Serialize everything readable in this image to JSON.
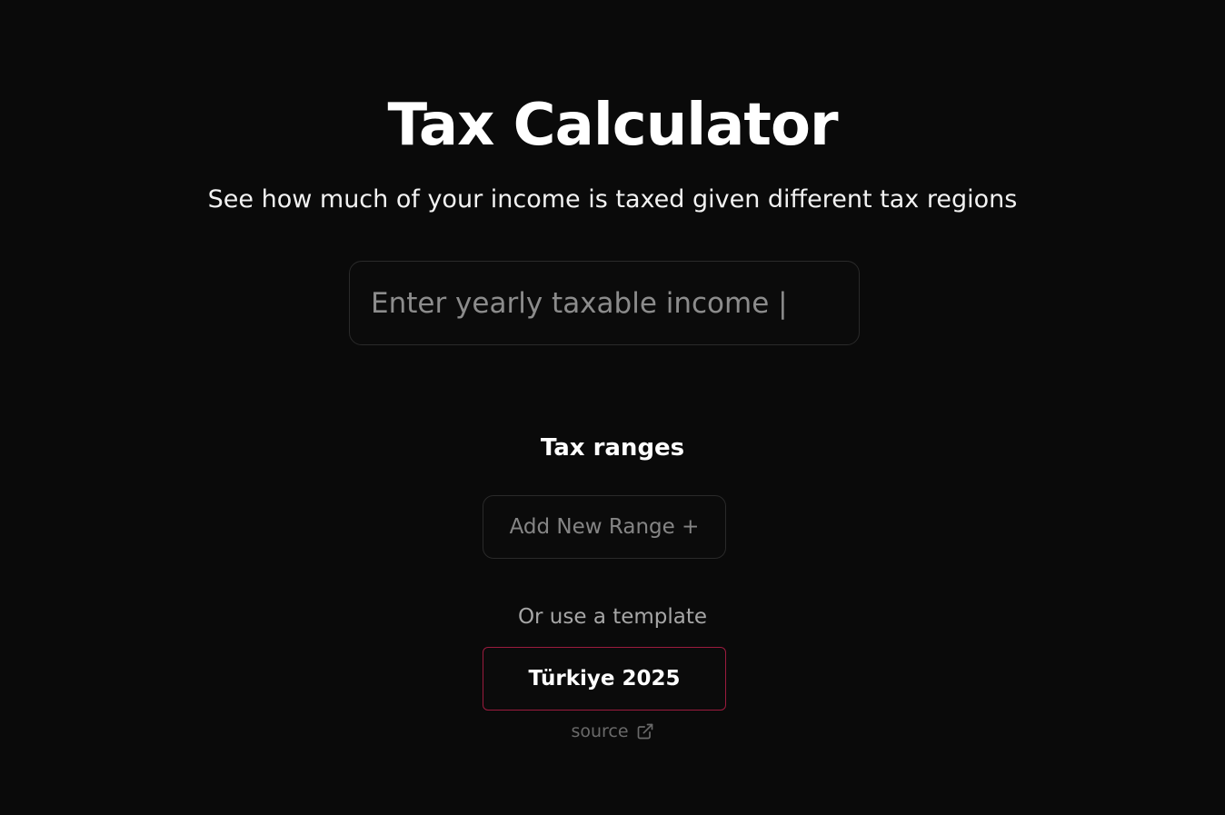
{
  "header": {
    "title": "Tax Calculator",
    "subtitle": "See how much of your income is taxed given different tax regions"
  },
  "income": {
    "placeholder": "Enter yearly taxable income |",
    "value": ""
  },
  "ranges": {
    "heading": "Tax ranges",
    "add_button_label": "Add New Range +"
  },
  "templates": {
    "label": "Or use a template",
    "items": [
      {
        "label": "Türkiye 2025",
        "source_label": "source",
        "source_icon": "external-link-icon"
      }
    ]
  },
  "colors": {
    "background": "#0a0a0a",
    "template_border": "#9b1b3e",
    "field_border": "#2a2a2a"
  }
}
